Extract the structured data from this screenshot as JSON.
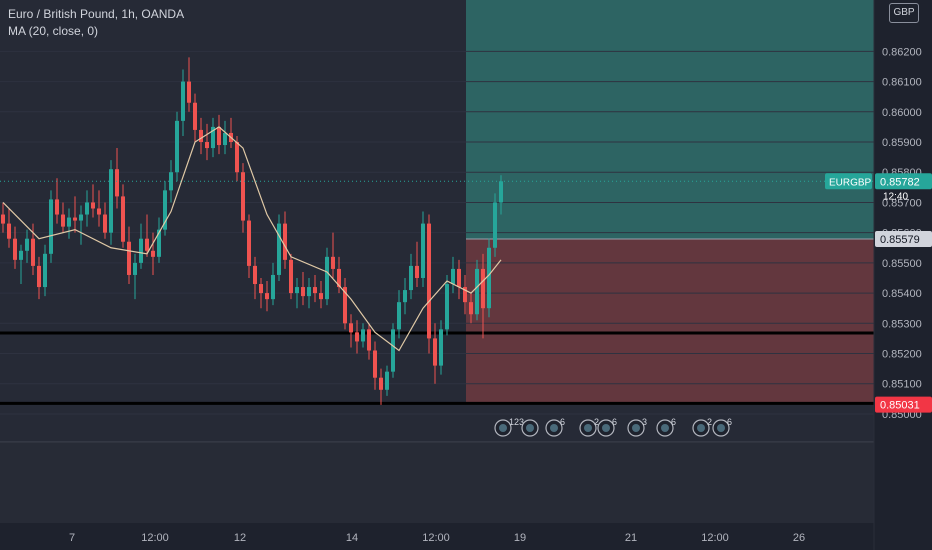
{
  "legend": {
    "title": "Euro / British Pound, 1h, OANDA",
    "indicator": "MA (20, close, 0)"
  },
  "currency_badge": "GBP",
  "colors": {
    "up": "#26a69a",
    "down": "#ef5350",
    "ma": "#e0c9a6",
    "profit_zone": "#2f6f6b",
    "loss_zone": "#6e3a40",
    "tag_symbol": "#26a69a",
    "tag_entry": "#d1d4dc",
    "tag_stop": "#f23645"
  },
  "chart_data": {
    "type": "candlestick",
    "series_name": "EURGBP",
    "ylim": [
      0.8498,
      0.8637
    ],
    "y_ticks": [
      "0.86200",
      "0.86100",
      "0.86000",
      "0.85900",
      "0.85800",
      "0.85700",
      "0.85600",
      "0.85500",
      "0.85400",
      "0.85300",
      "0.85200",
      "0.85100",
      "0.85000"
    ],
    "x_ticks": [
      "7",
      "12:00",
      "12",
      "14",
      "12:00",
      "19",
      "21",
      "12:00",
      "26"
    ],
    "last_price_tag": {
      "label": "EURGBP",
      "value": "0.85782",
      "countdown": "12:40"
    },
    "entry_tag": {
      "value": "0.85579"
    },
    "stop_tag": {
      "value": "0.85031"
    },
    "target_top": 0.8637,
    "entry": 0.85579,
    "stop": 0.85031,
    "support_lines": [
      0.85268,
      0.85035
    ],
    "ohlc": [
      [
        0.8566,
        0.857,
        0.856,
        0.8563
      ],
      [
        0.8563,
        0.8568,
        0.8555,
        0.8558
      ],
      [
        0.8558,
        0.8562,
        0.8548,
        0.8551
      ],
      [
        0.8551,
        0.8556,
        0.8543,
        0.8554
      ],
      [
        0.8554,
        0.8561,
        0.855,
        0.8558
      ],
      [
        0.8558,
        0.8563,
        0.8546,
        0.8549
      ],
      [
        0.8549,
        0.8552,
        0.8538,
        0.8542
      ],
      [
        0.8542,
        0.8556,
        0.8539,
        0.8553
      ],
      [
        0.8553,
        0.8574,
        0.855,
        0.8571
      ],
      [
        0.8571,
        0.8578,
        0.8563,
        0.8566
      ],
      [
        0.8566,
        0.857,
        0.856,
        0.8562
      ],
      [
        0.8562,
        0.8568,
        0.8558,
        0.8565
      ],
      [
        0.8565,
        0.8572,
        0.856,
        0.8564
      ],
      [
        0.8564,
        0.8569,
        0.8556,
        0.8566
      ],
      [
        0.8566,
        0.8574,
        0.8562,
        0.857
      ],
      [
        0.857,
        0.8576,
        0.8565,
        0.8568
      ],
      [
        0.8568,
        0.8574,
        0.8562,
        0.8566
      ],
      [
        0.8566,
        0.857,
        0.8558,
        0.856
      ],
      [
        0.856,
        0.8584,
        0.8556,
        0.8581
      ],
      [
        0.8581,
        0.8588,
        0.8568,
        0.8572
      ],
      [
        0.8572,
        0.8576,
        0.8555,
        0.8557
      ],
      [
        0.8557,
        0.8562,
        0.8543,
        0.8546
      ],
      [
        0.8546,
        0.8553,
        0.8538,
        0.855
      ],
      [
        0.855,
        0.8563,
        0.8548,
        0.8558
      ],
      [
        0.8558,
        0.8566,
        0.8552,
        0.8554
      ],
      [
        0.8554,
        0.856,
        0.8546,
        0.8552
      ],
      [
        0.8552,
        0.8565,
        0.855,
        0.8561
      ],
      [
        0.8561,
        0.8577,
        0.8559,
        0.8574
      ],
      [
        0.8574,
        0.8584,
        0.857,
        0.858
      ],
      [
        0.858,
        0.86,
        0.8577,
        0.8597
      ],
      [
        0.8597,
        0.8614,
        0.8592,
        0.861
      ],
      [
        0.861,
        0.8618,
        0.86,
        0.8603
      ],
      [
        0.8603,
        0.8606,
        0.859,
        0.8594
      ],
      [
        0.8594,
        0.8598,
        0.8586,
        0.859
      ],
      [
        0.859,
        0.8596,
        0.8584,
        0.8588
      ],
      [
        0.8588,
        0.8598,
        0.8585,
        0.8595
      ],
      [
        0.8595,
        0.8599,
        0.8586,
        0.8589
      ],
      [
        0.8589,
        0.8597,
        0.8586,
        0.8593
      ],
      [
        0.8593,
        0.8598,
        0.8588,
        0.859
      ],
      [
        0.859,
        0.8592,
        0.8577,
        0.858
      ],
      [
        0.858,
        0.8583,
        0.856,
        0.8564
      ],
      [
        0.8564,
        0.8566,
        0.8545,
        0.8549
      ],
      [
        0.8549,
        0.8552,
        0.8538,
        0.8543
      ],
      [
        0.8543,
        0.8545,
        0.8535,
        0.854
      ],
      [
        0.854,
        0.8544,
        0.8534,
        0.8538
      ],
      [
        0.8538,
        0.855,
        0.8536,
        0.8546
      ],
      [
        0.8546,
        0.8566,
        0.8544,
        0.8563
      ],
      [
        0.8563,
        0.8567,
        0.8548,
        0.8551
      ],
      [
        0.8551,
        0.8553,
        0.8538,
        0.854
      ],
      [
        0.854,
        0.8545,
        0.8535,
        0.8542
      ],
      [
        0.8542,
        0.8547,
        0.8536,
        0.8539
      ],
      [
        0.8539,
        0.8545,
        0.8535,
        0.8542
      ],
      [
        0.8542,
        0.8546,
        0.8537,
        0.854
      ],
      [
        0.854,
        0.8544,
        0.8535,
        0.8538
      ],
      [
        0.8538,
        0.8555,
        0.8536,
        0.8552
      ],
      [
        0.8552,
        0.856,
        0.8545,
        0.8548
      ],
      [
        0.8548,
        0.8552,
        0.854,
        0.8542
      ],
      [
        0.8542,
        0.8545,
        0.8528,
        0.853
      ],
      [
        0.853,
        0.8533,
        0.8522,
        0.8527
      ],
      [
        0.8527,
        0.8531,
        0.852,
        0.8524
      ],
      [
        0.8524,
        0.853,
        0.8522,
        0.8528
      ],
      [
        0.8528,
        0.853,
        0.8518,
        0.8521
      ],
      [
        0.8521,
        0.8524,
        0.8508,
        0.8512
      ],
      [
        0.8512,
        0.8515,
        0.8503,
        0.8508
      ],
      [
        0.8508,
        0.8516,
        0.8506,
        0.8514
      ],
      [
        0.8514,
        0.853,
        0.8512,
        0.8528
      ],
      [
        0.8528,
        0.8541,
        0.8525,
        0.8537
      ],
      [
        0.8537,
        0.8545,
        0.8533,
        0.8541
      ],
      [
        0.8541,
        0.8553,
        0.8538,
        0.8549
      ],
      [
        0.8549,
        0.8557,
        0.8542,
        0.8545
      ],
      [
        0.8545,
        0.8567,
        0.8542,
        0.8563
      ],
      [
        0.8563,
        0.8566,
        0.852,
        0.8525
      ],
      [
        0.8525,
        0.853,
        0.851,
        0.8516
      ],
      [
        0.8516,
        0.8531,
        0.8513,
        0.8528
      ],
      [
        0.8528,
        0.8546,
        0.8526,
        0.8543
      ],
      [
        0.8543,
        0.8552,
        0.854,
        0.8548
      ],
      [
        0.8548,
        0.8551,
        0.8538,
        0.8542
      ],
      [
        0.8542,
        0.8546,
        0.8533,
        0.8537
      ],
      [
        0.8537,
        0.854,
        0.853,
        0.8533
      ],
      [
        0.8533,
        0.8551,
        0.8531,
        0.8548
      ],
      [
        0.8548,
        0.8553,
        0.8525,
        0.8535
      ],
      [
        0.8535,
        0.8558,
        0.8532,
        0.8555
      ],
      [
        0.8555,
        0.8573,
        0.8552,
        0.857
      ],
      [
        0.857,
        0.8579,
        0.8566,
        0.8577
      ]
    ],
    "ma": [
      [
        0,
        0.857
      ],
      [
        6,
        0.8558
      ],
      [
        12,
        0.8561
      ],
      [
        18,
        0.8555
      ],
      [
        24,
        0.8553
      ],
      [
        28,
        0.8567
      ],
      [
        32,
        0.859
      ],
      [
        36,
        0.8595
      ],
      [
        40,
        0.8588
      ],
      [
        44,
        0.8566
      ],
      [
        48,
        0.8552
      ],
      [
        54,
        0.8547
      ],
      [
        58,
        0.8538
      ],
      [
        62,
        0.8527
      ],
      [
        66,
        0.8521
      ],
      [
        70,
        0.8535
      ],
      [
        74,
        0.8544
      ],
      [
        78,
        0.854
      ],
      [
        81,
        0.8546
      ],
      [
        83,
        0.8551
      ]
    ]
  }
}
